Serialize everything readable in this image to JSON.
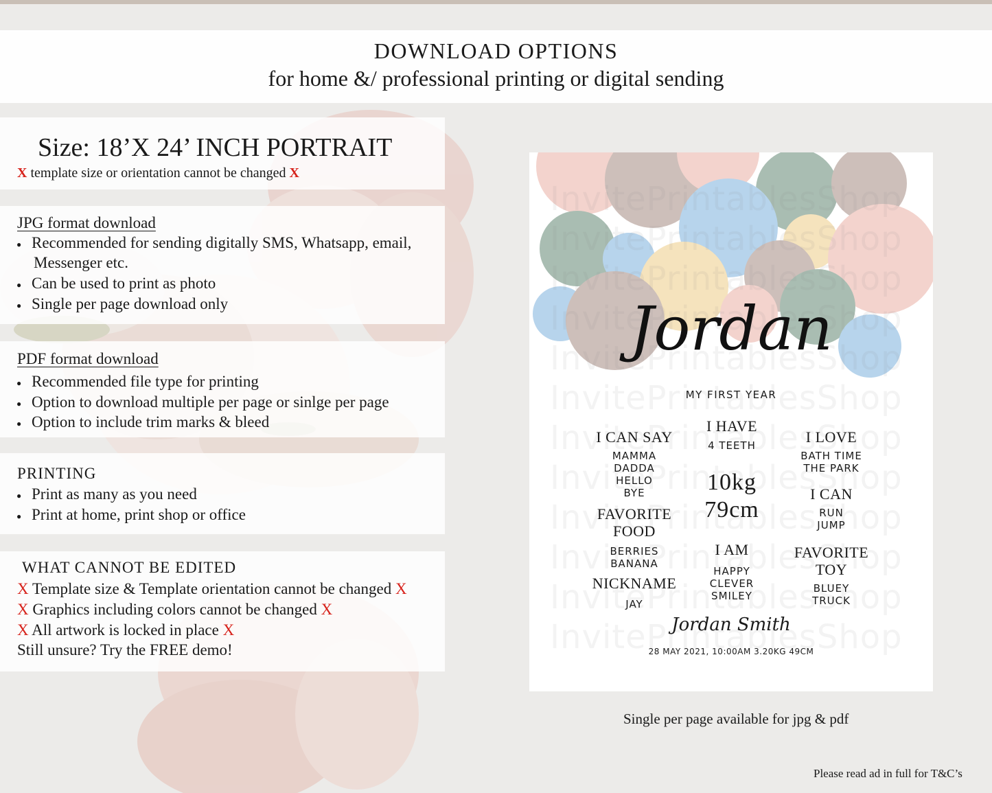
{
  "header": {
    "title": "DOWNLOAD OPTIONS",
    "subtitle": "for home &/ professional printing or digital sending"
  },
  "size_panel": {
    "heading": "Size: 18’X 24’ INCH PORTRAIT",
    "note": "template size or orientation cannot be changed",
    "mark": "X"
  },
  "jpg_panel": {
    "heading": "JPG format download",
    "items": [
      "Recommended for sending digitally SMS, Whatsapp, email,",
      "Messenger etc.",
      "Can be used to print as photo",
      "Single per page download only"
    ]
  },
  "pdf_panel": {
    "heading": "PDF format download",
    "items": [
      "Recommended file type for printing",
      "Option to download multiple per page or sinlge per page",
      "Option to include trim marks & bleed"
    ]
  },
  "printing_panel": {
    "heading": "PRINTING",
    "items": [
      "Print as many as you need",
      "Print at home, print shop or office"
    ]
  },
  "edit_panel": {
    "heading": "WHAT CANNOT BE EDITED",
    "mark": "X",
    "items": [
      "Template size & Template orientation cannot be changed",
      "Graphics including colors cannot be changed",
      "All artwork is locked in place"
    ],
    "demo": "Still unsure? Try the FREE demo!"
  },
  "poster": {
    "watermark": "InvitePrintablesShop",
    "name": "Jordan",
    "subtitle": "MY FIRST YEAR",
    "i_can_say": {
      "heading": "I CAN SAY",
      "values": [
        "MAMMA",
        "DADDA",
        "HELLO",
        "BYE"
      ]
    },
    "i_have": {
      "heading": "I HAVE",
      "value": "4 TEETH"
    },
    "i_love": {
      "heading": "I LOVE",
      "values": [
        "BATH TIME",
        "THE PARK"
      ]
    },
    "weight": "10kg",
    "height": "79cm",
    "i_can": {
      "heading": "I CAN",
      "values": [
        "RUN",
        "JUMP"
      ]
    },
    "favorite_food": {
      "heading_1": "FAVORITE",
      "heading_2": "FOOD",
      "values": [
        "BERRIES",
        "BANANA"
      ]
    },
    "i_am": {
      "heading": "I AM",
      "values": [
        "HAPPY",
        "CLEVER",
        "SMILEY"
      ]
    },
    "favorite_toy": {
      "heading_1": "FAVORITE",
      "heading_2": "TOY",
      "values": [
        "BLUEY",
        "TRUCK"
      ]
    },
    "nickname": {
      "heading": "NICKNAME",
      "value": "JAY"
    },
    "signature": "Jordan Smith",
    "birth_details": "28 MAY 2021, 10:00AM 3.20KG 49CM",
    "colors": {
      "pink": "#f3d3cd",
      "blue": "#b7d4ec",
      "sage": "#a9bdb2",
      "yellow": "#f5e3bd",
      "taupe": "#cdbfba"
    }
  },
  "caption": "Single per page available for jpg & pdf",
  "footer": "Please read ad in full for T&C’s"
}
